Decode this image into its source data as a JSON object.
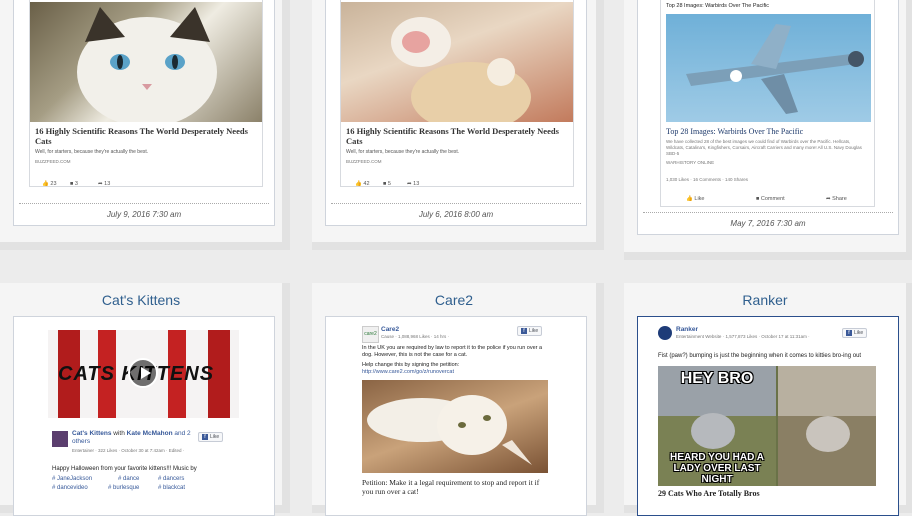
{
  "row1": [
    {
      "headline": "16 Highly Scientific Reasons The World Desperately Needs Cats",
      "description": "Well, for starters, because they're actually the best.",
      "domain": "BUZZFEED.COM",
      "likes": "23",
      "comments": "3",
      "shares": "13",
      "date": "July 9, 2016 7:30 am"
    },
    {
      "headline": "16 Highly Scientific Reasons The World Desperately Needs Cats",
      "description": "Well, for starters, because they're actually the best.",
      "domain": "BUZZFEED.COM",
      "likes": "42",
      "comments": "5",
      "shares": "13",
      "date": "July 6, 2016 8:00 am"
    },
    {
      "caption": "Top 28 Images: Warbirds Over The Pacific",
      "headline": "Top 28 Images: Warbirds Over The Pacific",
      "description": "We have collected 28 of the best images we could find of Warbirds over the Pacific. Hellcats, Wildcats, Catalina's, Kingfishers, Corsairs, Aircraft Carriers and many more! All U.S. Navy Douglas SBD-5",
      "domain": "WARHISTORY ONLINE",
      "stats": "1,030 Likes · 16 Comments · 140 Shares",
      "like_label": "Like",
      "comment_label": "Comment",
      "share_label": "Share",
      "date": "May 7, 2016 7:30 am"
    }
  ],
  "row2": [
    {
      "title": "Cat's Kittens",
      "video_text": "CATS KITTENS",
      "page_name": "Cat's Kittens",
      "with_text": "with",
      "with_name": "Kate McMahon",
      "others": "and 2 others",
      "meta": "Entertainer · 322 Likes · October 30 at 7:42am · Edited ·",
      "like_page": "Like",
      "message": "Happy Halloween from your favorite kittens!!! Music by",
      "tags": [
        "# JaneJackson",
        "# dance",
        "# dancers",
        "# dancevideo",
        "# burlesque",
        "# blackcat"
      ]
    },
    {
      "title": "Care2",
      "page_name": "Care2",
      "meta": "Cause · 1,088,968 Likes · 14 hrs ·",
      "like_page": "Like",
      "message": "In the UK you are required by law to report it to the police if you run over a dog. However, this is not the case for a cat.",
      "help_text": "Help change this by signing the petition:",
      "url": "http://www.care2.com/go/z/runovercat",
      "headline": "Petition: Make it a legal requirement to stop and report it if you run over a cat!"
    },
    {
      "title": "Ranker",
      "page_name": "Ranker",
      "meta": "Entertainment Website · 1,577,873 Likes · October 17 at 11:31am ·",
      "like_page": "Like",
      "message": "Fist (paw?) bumping is just the beginning when it comes to kitties bro-ing out",
      "meme_top": "HEY BRO",
      "meme_bottom": "HEARD YOU HAD A LADY OVER LAST NIGHT",
      "headline": "29 Cats Who Are Totally Bros"
    }
  ],
  "colors": {
    "title": "#2f5f8e",
    "fb_blue": "#3b5998",
    "link": "#365899"
  },
  "icons": [
    "thumbs-up-icon",
    "comment-icon",
    "share-icon",
    "facebook-icon",
    "play-icon"
  ]
}
